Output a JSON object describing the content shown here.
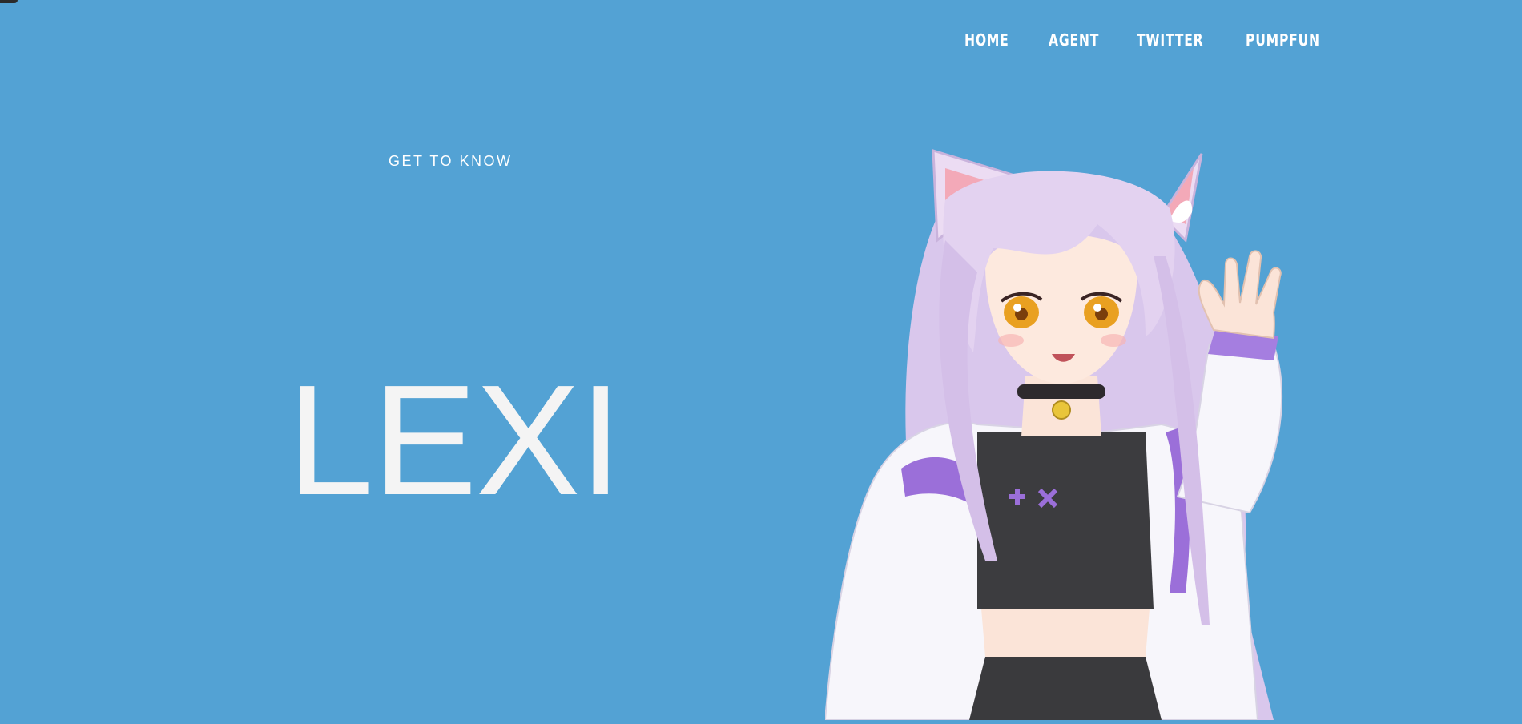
{
  "nav": {
    "items": [
      {
        "label": "HOME"
      },
      {
        "label": "AGENT"
      },
      {
        "label": "TWITTER"
      },
      {
        "label": "PUMPFUN"
      }
    ]
  },
  "hero": {
    "eyebrow": "GET TO KNOW",
    "name": "LEXI"
  },
  "colors": {
    "background": "#53a2d4",
    "text": "#ffffff",
    "hair": "#dccbea",
    "jacket": "#f7f6fb",
    "accent": "#9b6fd9",
    "top": "#3c3c3f",
    "eyes": "#e9a021"
  },
  "character": {
    "icon": "anime-catgirl-waving-illustration"
  }
}
